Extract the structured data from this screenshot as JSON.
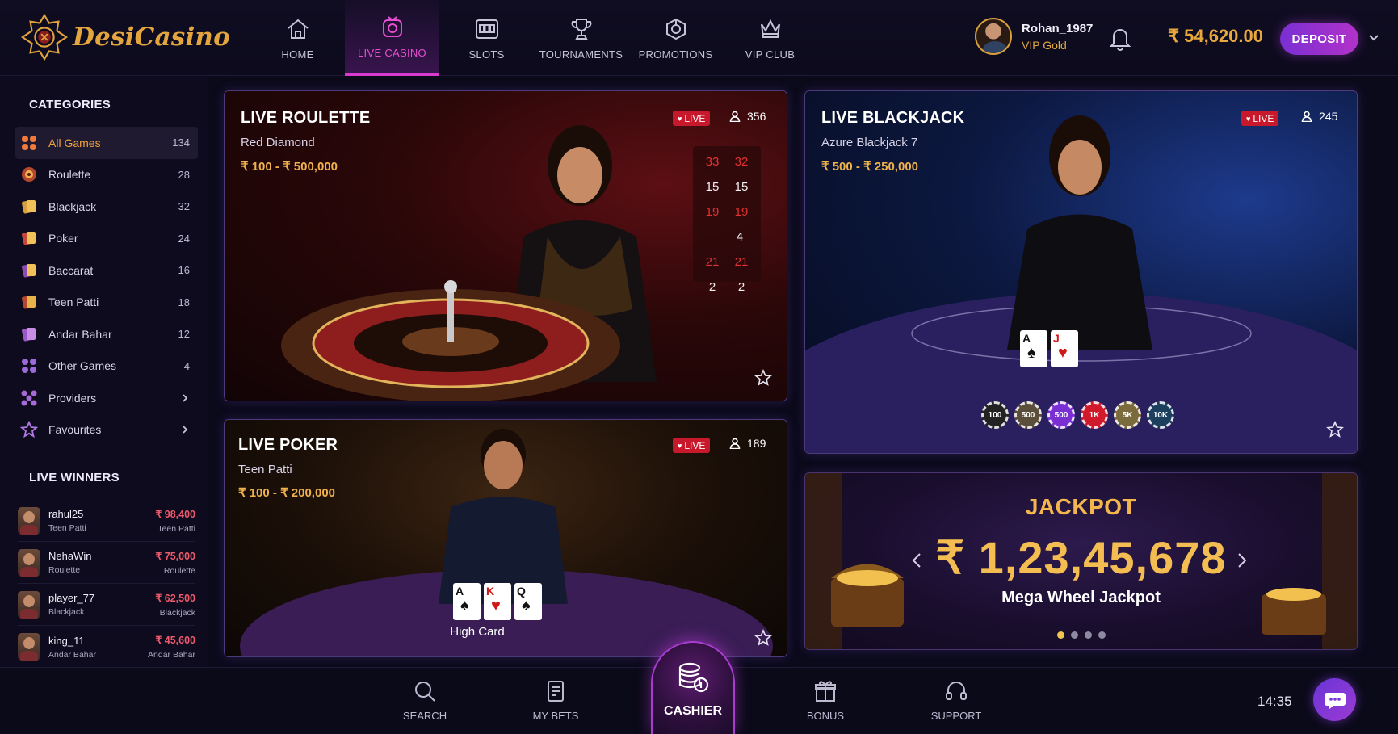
{
  "brand": {
    "name": "DesiCasino"
  },
  "nav": [
    {
      "label": "HOME",
      "icon": "home-icon",
      "active": false
    },
    {
      "label": "LIVE CASINO",
      "icon": "live-camera-icon",
      "active": true
    },
    {
      "label": "SLOTS",
      "icon": "slot-machine-icon",
      "active": false
    },
    {
      "label": "TOURNAMENTS",
      "icon": "trophy-icon",
      "active": false
    },
    {
      "label": "PROMOTIONS",
      "icon": "gift-tag-icon",
      "active": false
    },
    {
      "label": "VIP CLUB",
      "icon": "crown-icon",
      "active": false
    }
  ],
  "user": {
    "name": "Rohan_1987",
    "tier": "VIP Gold",
    "balance": "₹ 54,620.00"
  },
  "deposit_label": "DEPOSIT",
  "sidebar": {
    "categories_title": "CATEGORIES",
    "categories": [
      {
        "name": "All Games",
        "count": "134",
        "icon": "grid-icon"
      },
      {
        "name": "Roulette",
        "count": "28",
        "icon": "roulette-icon"
      },
      {
        "name": "Blackjack",
        "count": "32",
        "icon": "blackjack-icon"
      },
      {
        "name": "Poker",
        "count": "24",
        "icon": "poker-icon"
      },
      {
        "name": "Baccarat",
        "count": "16",
        "icon": "baccarat-icon"
      },
      {
        "name": "Teen Patti",
        "count": "18",
        "icon": "teen-patti-icon"
      },
      {
        "name": "Andar Bahar",
        "count": "12",
        "icon": "andar-bahar-icon"
      },
      {
        "name": "Other Games",
        "count": "4",
        "icon": "other-games-icon"
      },
      {
        "name": "Providers",
        "count": "",
        "icon": "providers-icon"
      },
      {
        "name": "Favourites",
        "count": "",
        "icon": "star-icon"
      }
    ],
    "winners_title": "LIVE WINNERS",
    "winners": [
      {
        "name": "rahul25",
        "game": "Teen Patti",
        "amount": "₹ 98,400",
        "game_right": "Teen Patti"
      },
      {
        "name": "NehaWin",
        "game": "Roulette",
        "amount": "₹ 75,000",
        "game_right": "Roulette"
      },
      {
        "name": "player_77",
        "game": "Blackjack",
        "amount": "₹ 62,500",
        "game_right": "Blackjack"
      },
      {
        "name": "king_11",
        "game": "Andar Bahar",
        "amount": "₹ 45,600",
        "game_right": "Andar Bahar"
      }
    ]
  },
  "games": {
    "roulette": {
      "title": "LIVE ROULETTE",
      "table": "Red Diamond",
      "range": "₹ 100 - ₹ 500,000",
      "live": "LIVE",
      "viewers": "356",
      "history": [
        [
          "33",
          "32"
        ],
        [
          "15",
          "15"
        ],
        [
          "19",
          "19"
        ],
        [
          "",
          "4"
        ],
        [
          "21",
          "21"
        ],
        [
          "2",
          "2"
        ]
      ]
    },
    "blackjack": {
      "title": "LIVE BLACKJACK",
      "table": "Azure Blackjack 7",
      "range": "₹ 500 - ₹ 250,000",
      "live": "LIVE",
      "viewers": "245",
      "chips": [
        "100",
        "500",
        "500",
        "1K",
        "5K",
        "10K"
      ]
    },
    "poker": {
      "title": "LIVE POKER",
      "table": "Teen Patti",
      "range": "₹ 100 - ₹ 200,000",
      "live": "LIVE",
      "viewers": "189",
      "hand_label": "High Card",
      "cards": [
        [
          "A",
          "♠"
        ],
        [
          "K",
          "♥"
        ],
        [
          "Q",
          "♠"
        ]
      ]
    }
  },
  "jackpot": {
    "title": "JACKPOT",
    "amount": "₹ 1,23,45,678",
    "name": "Mega Wheel Jackpot",
    "slides": 4,
    "active_slide": 1
  },
  "bottom_nav": {
    "search": "SEARCH",
    "bets": "MY BETS",
    "cashier": "CASHIER",
    "bonus": "BONUS",
    "support": "SUPPORT"
  },
  "clock": "14:35",
  "colors": {
    "accent": "#d93bd0",
    "gold": "#e8a83e",
    "live": "#c8182b",
    "bg": "#0b0a1a"
  }
}
